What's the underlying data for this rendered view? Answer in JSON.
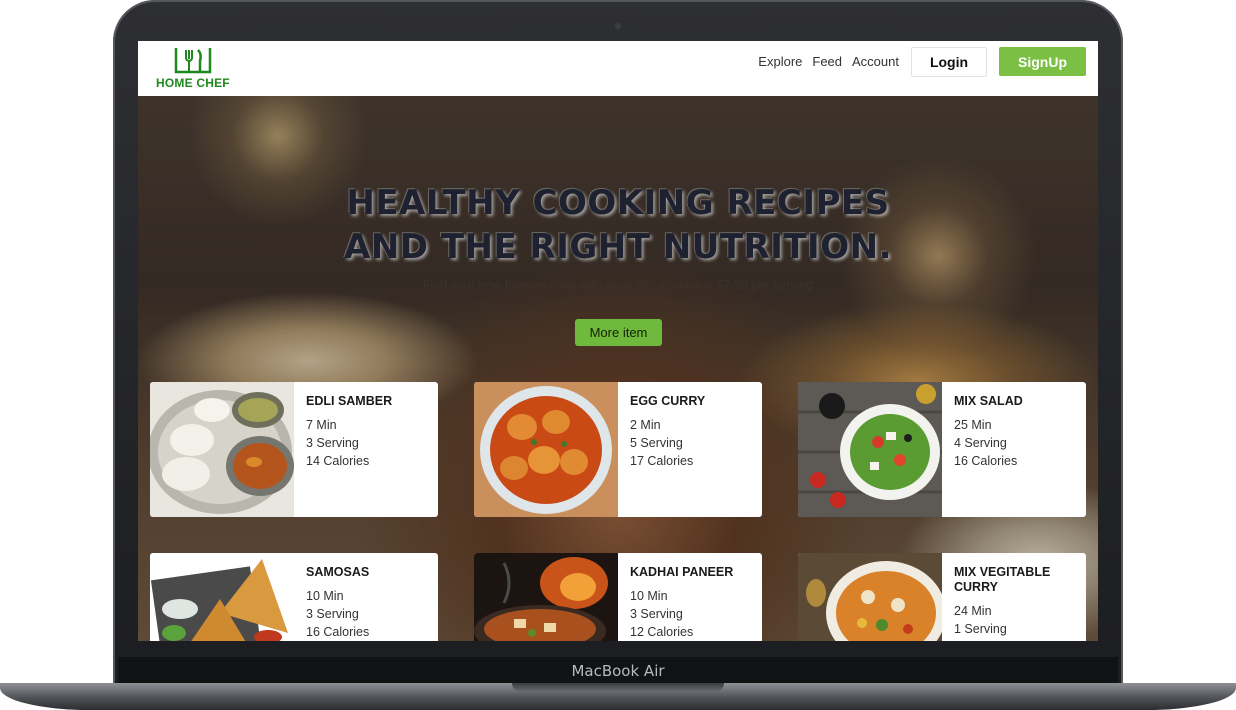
{
  "device": {
    "label": "MacBook Air"
  },
  "brand": {
    "name": "HOME CHEF",
    "color": "#1e8a1e"
  },
  "nav": {
    "links": [
      "Explore",
      "Feed",
      "Account"
    ],
    "login_label": "Login",
    "signup_label": "SignUp",
    "signup_color": "#7cbf45"
  },
  "hero": {
    "title_line1": "HEALTHY COOKING RECIPES",
    "title_line2": "AND THE RIGHT NUTRITION.",
    "subtitle": "Find your new favorite meal with meal kits starting at $7.99 per serving",
    "cta_label": "More item"
  },
  "recipes": [
    {
      "title": "EDLI SAMBER",
      "time": "7 Min",
      "servings": "3 Serving",
      "calories": "14 Calories",
      "image": "idli-sambar-photo"
    },
    {
      "title": "EGG CURRY",
      "time": "2 Min",
      "servings": "5 Serving",
      "calories": "17 Calories",
      "image": "egg-curry-photo"
    },
    {
      "title": "MIX SALAD",
      "time": "25 Min",
      "servings": "4 Serving",
      "calories": "16 Calories",
      "image": "mix-salad-photo"
    },
    {
      "title": "SAMOSAS",
      "time": "10 Min",
      "servings": "3 Serving",
      "calories": "16 Calories",
      "image": "samosas-photo"
    },
    {
      "title": "KADHAI PANEER",
      "time": "10 Min",
      "servings": "3 Serving",
      "calories": "12 Calories",
      "image": "kadhai-paneer-photo"
    },
    {
      "title": "MIX VEGITABLE CURRY",
      "time": "24 Min",
      "servings": "1 Serving",
      "calories": "",
      "image": "mix-vegetable-curry-photo"
    }
  ]
}
